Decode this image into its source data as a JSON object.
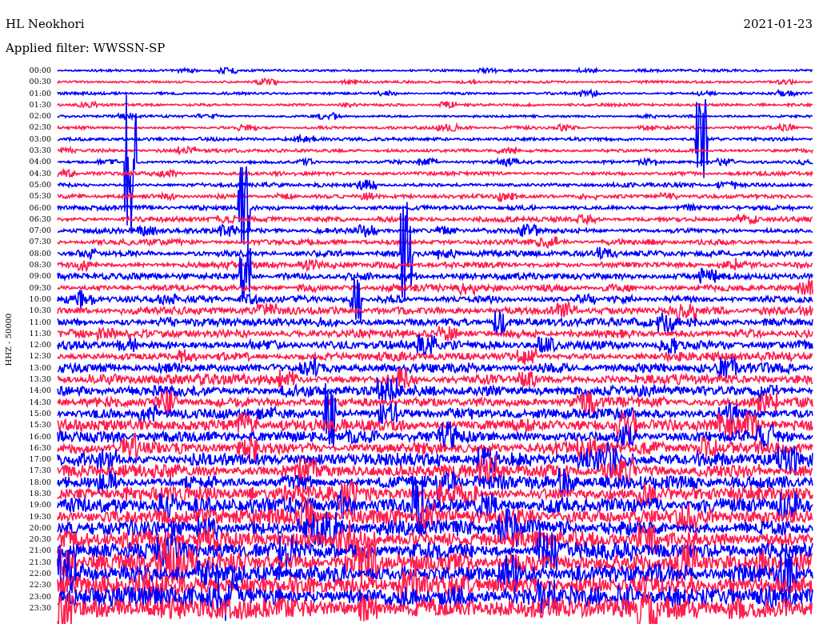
{
  "station": "HL Neokhori",
  "date": "2021-01-23",
  "filter": "Applied filter: WWSSN-SP",
  "axis_label": "HHZ - 50000",
  "traces": [
    {
      "time": "00:00",
      "color": "#0000ff"
    },
    {
      "time": "00:30",
      "color": "#ff1f4f"
    },
    {
      "time": "01:00",
      "color": "#0000ff"
    },
    {
      "time": "01:30",
      "color": "#ff1f4f"
    },
    {
      "time": "02:00",
      "color": "#0000ff"
    },
    {
      "time": "02:30",
      "color": "#ff1f4f"
    },
    {
      "time": "03:00",
      "color": "#0000ff"
    },
    {
      "time": "03:30",
      "color": "#ff1f4f"
    },
    {
      "time": "04:00",
      "color": "#0000ff"
    },
    {
      "time": "04:30",
      "color": "#ff1f4f"
    },
    {
      "time": "05:00",
      "color": "#0000ff"
    },
    {
      "time": "05:30",
      "color": "#ff1f4f"
    },
    {
      "time": "06:00",
      "color": "#0000ff"
    },
    {
      "time": "06:30",
      "color": "#ff1f4f"
    },
    {
      "time": "07:00",
      "color": "#0000ff"
    },
    {
      "time": "07:30",
      "color": "#ff1f4f"
    },
    {
      "time": "08:00",
      "color": "#0000ff"
    },
    {
      "time": "08:30",
      "color": "#ff1f4f"
    },
    {
      "time": "09:00",
      "color": "#0000ff"
    },
    {
      "time": "09:30",
      "color": "#ff1f4f"
    },
    {
      "time": "10:00",
      "color": "#0000ff"
    },
    {
      "time": "10:30",
      "color": "#ff1f4f"
    },
    {
      "time": "11:00",
      "color": "#0000ff"
    },
    {
      "time": "11:30",
      "color": "#ff1f4f"
    },
    {
      "time": "12:00",
      "color": "#0000ff"
    },
    {
      "time": "12:30",
      "color": "#ff1f4f"
    },
    {
      "time": "13:00",
      "color": "#0000ff"
    },
    {
      "time": "13:30",
      "color": "#ff1f4f"
    },
    {
      "time": "14:00",
      "color": "#0000ff"
    },
    {
      "time": "14:30",
      "color": "#ff1f4f"
    },
    {
      "time": "15:00",
      "color": "#0000ff"
    },
    {
      "time": "15:30",
      "color": "#ff1f4f"
    },
    {
      "time": "16:00",
      "color": "#0000ff"
    },
    {
      "time": "16:30",
      "color": "#ff1f4f"
    },
    {
      "time": "17:00",
      "color": "#0000ff"
    },
    {
      "time": "17:30",
      "color": "#ff1f4f"
    },
    {
      "time": "18:00",
      "color": "#0000ff"
    },
    {
      "time": "18:30",
      "color": "#ff1f4f"
    },
    {
      "time": "19:00",
      "color": "#0000ff"
    },
    {
      "time": "19:30",
      "color": "#ff1f4f"
    },
    {
      "time": "20:00",
      "color": "#0000ff"
    },
    {
      "time": "20:30",
      "color": "#ff1f4f"
    },
    {
      "time": "21:00",
      "color": "#0000ff"
    },
    {
      "time": "21:30",
      "color": "#ff1f4f"
    },
    {
      "time": "22:00",
      "color": "#0000ff"
    },
    {
      "time": "22:30",
      "color": "#ff1f4f"
    },
    {
      "time": "23:00",
      "color": "#0000ff"
    },
    {
      "time": "23:30",
      "color": "#ff1f4f"
    }
  ]
}
